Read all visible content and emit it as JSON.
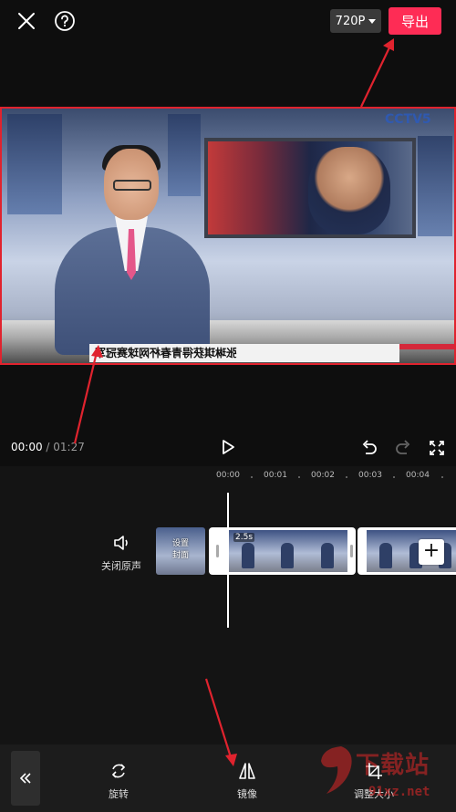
{
  "topbar": {
    "resolution": "720P",
    "export_label": "导出"
  },
  "preview": {
    "ticker_text": "张琳琪获得青春杯网球赛冠军",
    "logo_text": "CCTV5"
  },
  "playback": {
    "current_time": "00:00",
    "total_time": "/ 01:27"
  },
  "timeline": {
    "ruler_ticks": [
      "00:00",
      "00:01",
      "00:02",
      "00:03",
      "00:04"
    ],
    "mute_label": "关闭原声",
    "cover_label": "设置\n封面",
    "clip_duration": "2.5s"
  },
  "toolbar": {
    "tools": [
      {
        "label": "旋转",
        "icon": "rotate-icon"
      },
      {
        "label": "镜像",
        "icon": "mirror-icon"
      },
      {
        "label": "调整大小",
        "icon": "crop-icon"
      }
    ]
  },
  "watermark": {
    "text": "下载站",
    "url": "91xz.net"
  },
  "colors": {
    "accent": "#fe2c55",
    "annotation": "#e0232e",
    "background": "#0e0e0e"
  }
}
